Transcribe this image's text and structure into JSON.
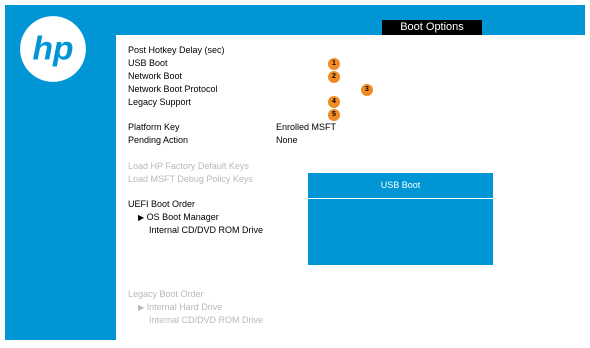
{
  "header": {
    "tab_label": "Boot Options"
  },
  "boot_options": [
    {
      "label": "Post Hotkey Delay (sec)",
      "value": ""
    },
    {
      "label": "USB Boot",
      "value": ""
    },
    {
      "label": "Network Boot",
      "value": ""
    },
    {
      "label": "Network Boot Protocol",
      "value": ""
    },
    {
      "label": "Legacy Support",
      "value": ""
    },
    {
      "label": "Platform Key",
      "value": "Enrolled MSFT"
    },
    {
      "label": "Pending Action",
      "value": "None"
    }
  ],
  "badges": [
    "1",
    "2",
    "3",
    "4",
    "5"
  ],
  "load_keys": [
    "Load HP Factory Default Keys",
    "Load MSFT Debug Policy Keys"
  ],
  "uefi_boot_order": {
    "title": "UEFI Boot Order",
    "items": [
      "OS Boot Manager",
      "Internal CD/DVD ROM Drive"
    ]
  },
  "legacy_boot_order": {
    "title": "Legacy Boot Order",
    "items": [
      "Internal Hard Drive",
      "Internal CD/DVD ROM Drive"
    ]
  },
  "popup": {
    "title": "USB Boot"
  },
  "colors": {
    "hp_blue": "#0096d6",
    "badge_orange": "#f08a24",
    "tab_black": "#000000",
    "muted_text": "#b9b9b9"
  },
  "icons": {
    "logo": "hp-logo",
    "arrow": "right-triangle-icon"
  }
}
